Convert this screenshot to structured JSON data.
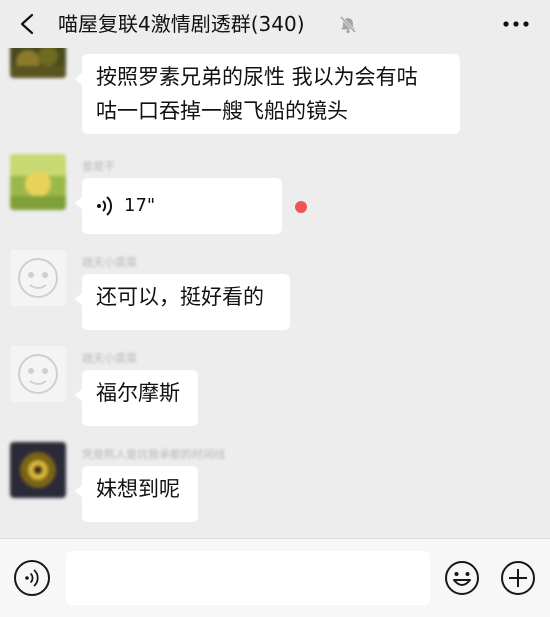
{
  "header": {
    "title": "喵屋复联4激情剧透群(340)",
    "back_icon": "chevron-left-icon",
    "mute_icon": "bell-off-icon",
    "more_icon": "more-dots-icon"
  },
  "messages": [
    {
      "sender": "",
      "type": "text",
      "lines": [
        "按照罗素兄弟的尿性 我以为会有咕",
        "咕一口吞掉一艘飞船的镜头"
      ]
    },
    {
      "sender": "昔是不",
      "type": "voice",
      "duration": "17\"",
      "unread": true
    },
    {
      "sender": "疏天小菜菜",
      "type": "text",
      "lines": [
        "还可以，挺好看的"
      ]
    },
    {
      "sender": "疏天小菜菜",
      "type": "text",
      "lines": [
        "福尔摩斯"
      ]
    },
    {
      "sender": "凭是熊人是坑我承都的时间线",
      "type": "text",
      "lines": [
        "妹想到呢"
      ]
    }
  ],
  "input": {
    "value": "",
    "placeholder": ""
  },
  "toolbar": {
    "voice_icon": "voice-input-icon",
    "emoji_icon": "emoji-icon",
    "add_icon": "plus-icon"
  },
  "colors": {
    "background": "#ededed",
    "bubble": "#ffffff",
    "unread_dot": "#f05555"
  }
}
